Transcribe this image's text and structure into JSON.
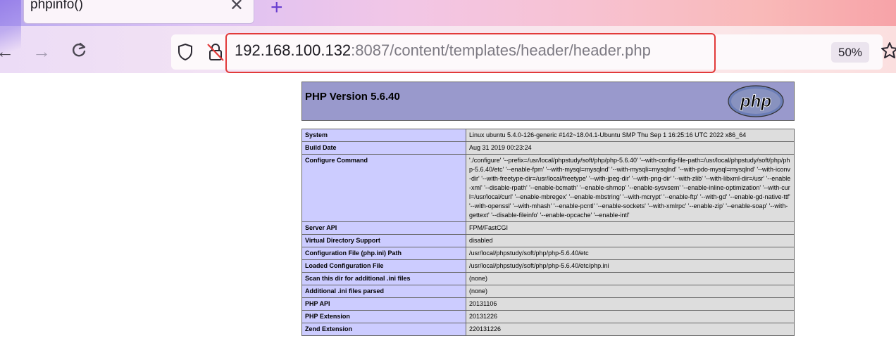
{
  "browser": {
    "tab_title": "phpinfo()",
    "tab_close_icon": "close-icon",
    "new_tab_icon": "plus-icon",
    "url_host": "192.168.100.132",
    "url_rest": ":8087/content/templates/header/header.php",
    "zoom": "50%"
  },
  "php": {
    "version_title": "PHP Version 5.6.40",
    "logo_text": "php",
    "rows": [
      {
        "label": "System",
        "value": "Linux ubuntu 5.4.0-126-generic #142~18.04.1-Ubuntu SMP Thu Sep 1 16:25:16 UTC 2022 x86_64"
      },
      {
        "label": "Build Date",
        "value": "Aug 31 2019 00:23:24"
      },
      {
        "label": "Configure Command",
        "value": "'./configure' '--prefix=/usr/local/phpstudy/soft/php/php-5.6.40' '--with-config-file-path=/usr/local/phpstudy/soft/php/php-5.6.40/etc' '--enable-fpm' '--with-mysql=mysqlnd' '--with-mysqli=mysqlnd' '--with-pdo-mysql=mysqlnd' '--with-iconv-dir' '--with-freetype-dir=/usr/local/freetype' '--with-jpeg-dir' '--with-png-dir' '--with-zlib' '--with-libxml-dir=/usr' '--enable-xml' '--disable-rpath' '--enable-bcmath' '--enable-shmop' '--enable-sysvsem' '--enable-inline-optimization' '--with-curl=/usr/local/curl' '--enable-mbregex' '--enable-mbstring' '--with-mcrypt' '--enable-ftp' '--with-gd' '--enable-gd-native-ttf' '--with-openssl' '--with-mhash' '--enable-pcntl' '--enable-sockets' '--with-xmlrpc' '--enable-zip' '--enable-soap' '--with-gettext' '--disable-fileinfo' '--enable-opcache' '--enable-intl'"
      },
      {
        "label": "Server API",
        "value": "FPM/FastCGI"
      },
      {
        "label": "Virtual Directory Support",
        "value": "disabled"
      },
      {
        "label": "Configuration File (php.ini) Path",
        "value": "/usr/local/phpstudy/soft/php/php-5.6.40/etc"
      },
      {
        "label": "Loaded Configuration File",
        "value": "/usr/local/phpstudy/soft/php/php-5.6.40/etc/php.ini"
      },
      {
        "label": "Scan this dir for additional .ini files",
        "value": "(none)"
      },
      {
        "label": "Additional .ini files parsed",
        "value": "(none)"
      },
      {
        "label": "PHP API",
        "value": "20131106"
      },
      {
        "label": "PHP Extension",
        "value": "20131226"
      },
      {
        "label": "Zend Extension",
        "value": "220131226"
      }
    ]
  },
  "colors": {
    "header_bg": "#9999cc",
    "label_bg": "#ccccff",
    "value_bg": "#dddddd",
    "url_highlight": "#e23a3a"
  }
}
